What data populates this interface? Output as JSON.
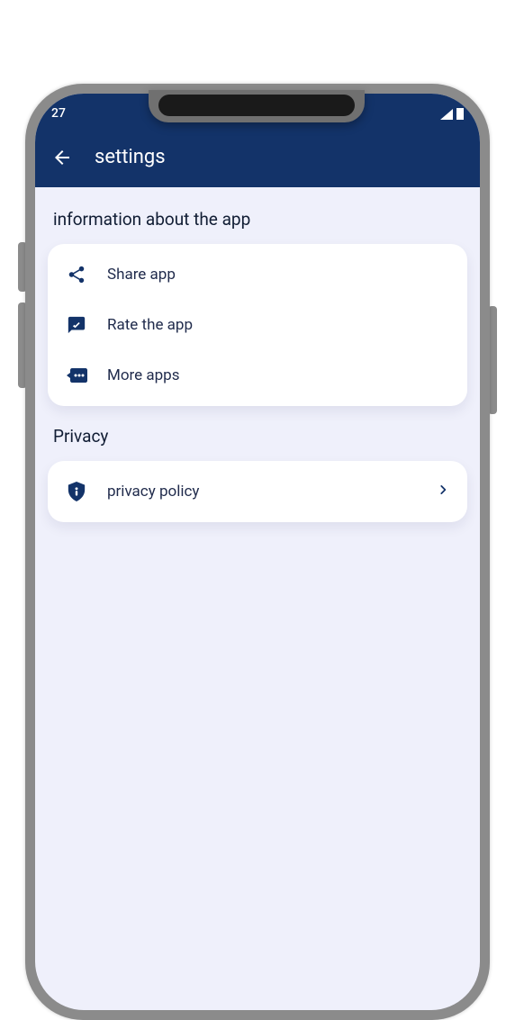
{
  "status": {
    "time": "27"
  },
  "appbar": {
    "title": "settings"
  },
  "sections": {
    "info": {
      "title": "information about the app",
      "items": {
        "share": {
          "label": "Share app"
        },
        "rate": {
          "label": "Rate the app"
        },
        "more": {
          "label": "More apps"
        }
      }
    },
    "privacy": {
      "title": "Privacy",
      "items": {
        "policy": {
          "label": "privacy policy"
        }
      }
    }
  },
  "colors": {
    "header": "#133369",
    "bg": "#eff0fb"
  }
}
